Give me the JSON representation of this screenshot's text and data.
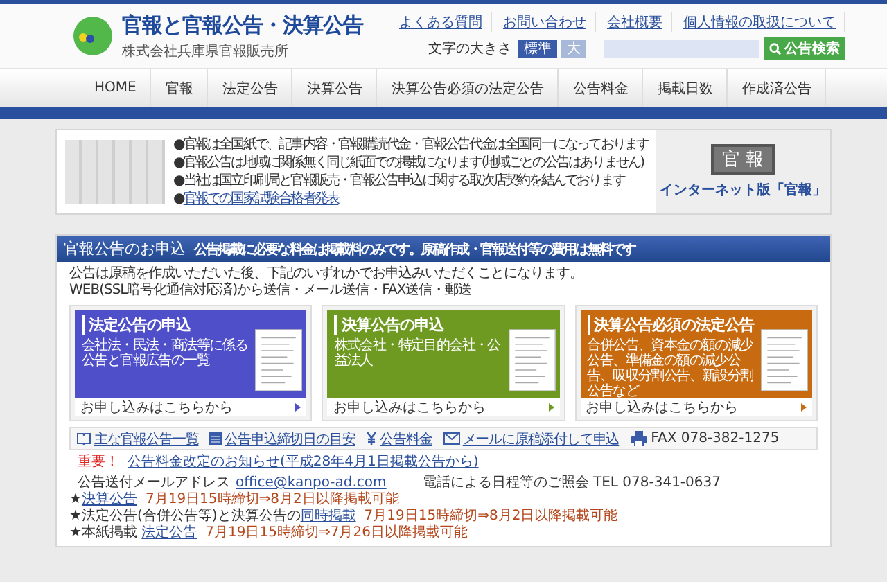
{
  "header": {
    "title": "官報と官報公告・決算公告",
    "subtitle": "株式会社兵庫県官報販売所",
    "top_links": [
      "よくある質問",
      "お問い合わせ",
      "会社概要",
      "個人情報の取扱について"
    ],
    "font_size_label": "文字の大きさ",
    "font_sizes": [
      {
        "label": "標準",
        "selected": true
      },
      {
        "label": "大",
        "selected": false
      }
    ],
    "search_button": "公告検索"
  },
  "nav": [
    "HOME",
    "官報",
    "法定公告",
    "決算公告",
    "決算公告必須の法定公告",
    "公告料金",
    "掲載日数",
    "作成済公告"
  ],
  "info": {
    "bullets": [
      {
        "kind": "text",
        "text": "●官報は全国紙で、記事内容・官報購読代金・官報公告代金は全国同一になっております"
      },
      {
        "kind": "text",
        "text": "●官報公告は地域に関係無く同じ紙面での掲載になります(地域ごとの公告はありません)"
      },
      {
        "kind": "text",
        "text": "●当社は国立印刷局と官報販売・官報公告申込に関する取次店契約を結んでおります"
      },
      {
        "kind": "link",
        "marker": "●",
        "text": "官報での国家試験合格者発表"
      }
    ],
    "logo_text": "官 報",
    "internet_link": "インターネット版「官報」"
  },
  "section": {
    "title": "官報公告のお申込",
    "subtitle": "公告掲載に必要な料金は掲載料のみです。原稿作成・官報送付等の費用は無料です",
    "intro": [
      "公告は原稿を作成いただいた後、下記のいずれかでお申込みいただくことになります。",
      "WEB(SSL暗号化通信対応済)から送信・メール送信・FAX送信・郵送"
    ],
    "cards": [
      {
        "title": "法定公告の申込",
        "body": "会社法・民法・商法等に係る公告と官報広告の一覧",
        "footer": "お申し込みはこちらから",
        "color": "#4f4fc9"
      },
      {
        "title": "決算公告の申込",
        "body": "株式会社・特定目的会社・公益法人",
        "footer": "お申し込みはこちらから",
        "color": "#6f9a22"
      },
      {
        "title": "決算公告必須の法定公告",
        "body": "合併公告、資本金の額の減少公告、準備金の額の減少公告、吸収分割公告、新設分割公告など",
        "footer": "お申し込みはこちらから",
        "color": "#c86a10"
      }
    ],
    "quick_links": [
      {
        "kind": "book",
        "text": "主な官報公告一覧"
      },
      {
        "kind": "calendar",
        "text": "公告申込締切日の目安"
      },
      {
        "kind": "yen",
        "text": "公告料金"
      },
      {
        "kind": "mail",
        "text": "メールに原稿添付して申込"
      }
    ],
    "fax": "FAX  078-382-1275",
    "notice_label": "重要！",
    "notice_link": "公告料金改定のお知らせ(平成28年4月1日掲載公告から)",
    "mail_label": "公告送付メールアドレス",
    "mail_link": "office@kanpo-ad.com",
    "phone": "電話による日程等のご照会  TEL 078-341-0637",
    "schedule": [
      {
        "prefix": "★",
        "link": "決算公告",
        "deadline": "7月19日15時締切⇒8月2日以降掲載可能"
      },
      {
        "prefix": "★",
        "pre_text": "法定公告(合併公告等)と決算公告の",
        "link": "同時掲載",
        "deadline": "7月19日15時締切⇒8月2日以降掲載可能"
      },
      {
        "prefix": "★",
        "pre_text": "本紙掲載 ",
        "link": "法定公告",
        "deadline": "7月19日15時締切⇒7月26日以降掲載可能"
      }
    ]
  }
}
